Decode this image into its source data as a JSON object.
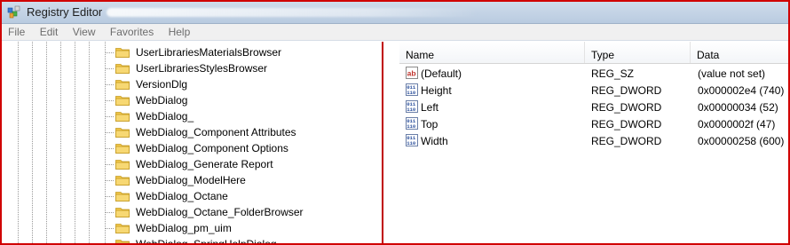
{
  "window": {
    "title": "Registry Editor"
  },
  "menu": [
    "File",
    "Edit",
    "View",
    "Favorites",
    "Help"
  ],
  "tree": {
    "items": [
      "UserLibrariesMaterialsBrowser",
      "UserLibrariesStylesBrowser",
      "VersionDlg",
      "WebDialog",
      "WebDialog_",
      "WebDialog_Component Attributes",
      "WebDialog_Component Options",
      "WebDialog_Generate Report",
      "WebDialog_ModelHere",
      "WebDialog_Octane",
      "WebDialog_Octane_FolderBrowser",
      "WebDialog_pm_uim",
      "WebDialog_SpringHelpDialog"
    ]
  },
  "values": {
    "columns": [
      "Name",
      "Type",
      "Data"
    ],
    "rows": [
      {
        "icon": "string-value-icon",
        "name": "(Default)",
        "type": "REG_SZ",
        "data": "(value not set)"
      },
      {
        "icon": "binary-value-icon",
        "name": "Height",
        "type": "REG_DWORD",
        "data": "0x000002e4 (740)"
      },
      {
        "icon": "binary-value-icon",
        "name": "Left",
        "type": "REG_DWORD",
        "data": "0x00000034 (52)"
      },
      {
        "icon": "binary-value-icon",
        "name": "Top",
        "type": "REG_DWORD",
        "data": "0x0000002f (47)"
      },
      {
        "icon": "binary-value-icon",
        "name": "Width",
        "type": "REG_DWORD",
        "data": "0x00000258 (600)"
      }
    ]
  },
  "colors": {
    "accent_border": "#d00000",
    "folder": "#f2c84b"
  }
}
